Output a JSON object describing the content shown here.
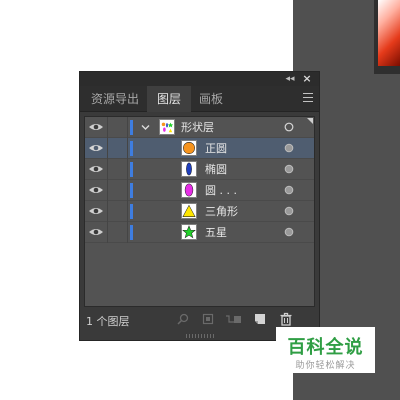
{
  "panel": {
    "tabs": [
      {
        "label": "资源导出"
      },
      {
        "label": "图层"
      },
      {
        "label": "画板"
      }
    ],
    "active_tab": "图层"
  },
  "layers": [
    {
      "name": "形状层",
      "shape": "group",
      "selected": false
    },
    {
      "name": "正圆",
      "shape": "circle",
      "color": "#f7941d",
      "selected": true
    },
    {
      "name": "椭圆",
      "shape": "ellipse",
      "color": "#1f3fbf",
      "selected": false
    },
    {
      "name": "圆 . . .",
      "shape": "ellipse-pink",
      "color": "#e62ee6",
      "selected": false
    },
    {
      "name": "三角形",
      "shape": "triangle",
      "color": "#ffe600",
      "selected": false
    },
    {
      "name": "五星",
      "shape": "star",
      "color": "#22d22a",
      "selected": false
    }
  ],
  "footer": {
    "status": "1 个图层"
  },
  "watermark": {
    "title": "百科全说",
    "subtitle": "助你轻松解决"
  },
  "colors": {
    "accent_bar": "#3e7de0",
    "selected_row": "#4f5d70",
    "watermark_green": "#2f9e44"
  }
}
